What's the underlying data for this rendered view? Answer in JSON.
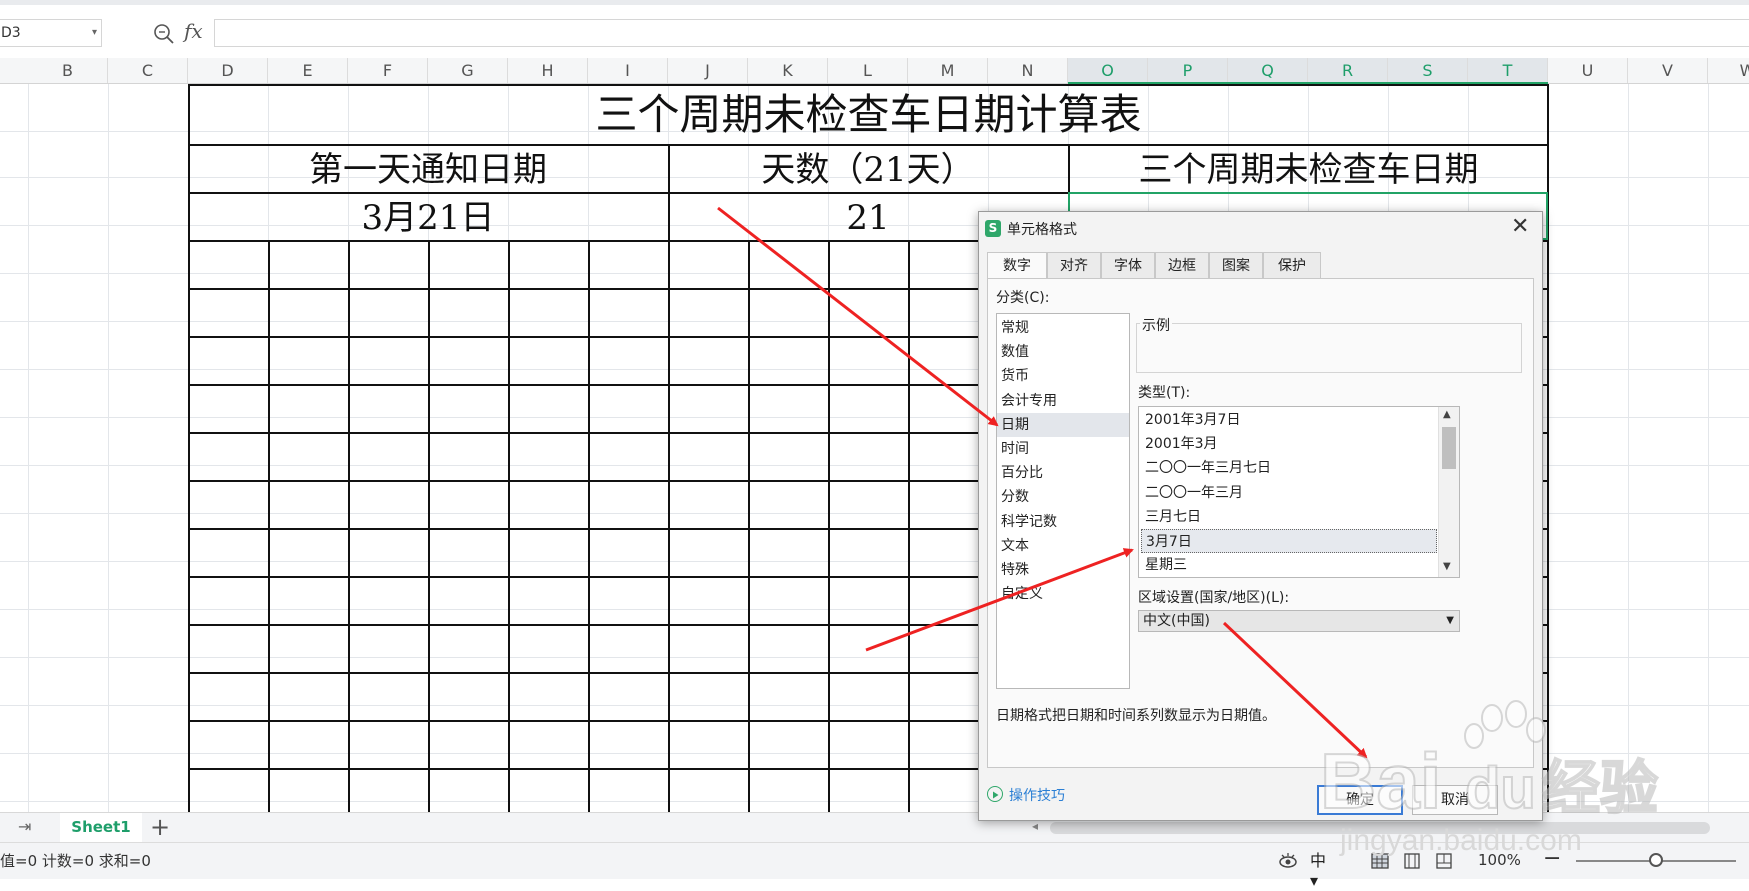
{
  "formula_bar": {
    "name_box": "D3",
    "fx": "fx",
    "formula": ""
  },
  "columns": [
    "B",
    "C",
    "D",
    "E",
    "F",
    "G",
    "H",
    "I",
    "J",
    "K",
    "L",
    "M",
    "N",
    "O",
    "P",
    "Q",
    "R",
    "S",
    "T",
    "U",
    "V",
    "W"
  ],
  "selected_columns": [
    "O",
    "P",
    "Q",
    "R",
    "S",
    "T"
  ],
  "table": {
    "title": "三个周期未检查车日期计算表",
    "header_first_day": "第一天通知日期",
    "header_days": "天数（21天）",
    "header_third_period": "三个周期未检查车日期",
    "value_first_day": "3月21日",
    "value_days": "21"
  },
  "sheet_bar": {
    "nav_end": "⇥",
    "tab": "Sheet1",
    "add": "+"
  },
  "status_bar": {
    "stats": "值=0  计数=0  求和=0",
    "zoom": "100%",
    "zoom_level": 0.5
  },
  "dialog": {
    "title": "单元格格式",
    "icon_letter": "S",
    "close": "✕",
    "tabs": [
      "数字",
      "对齐",
      "字体",
      "边框",
      "图案",
      "保护"
    ],
    "active_tab": "数字",
    "category_label": "分类(C):",
    "categories": [
      "常规",
      "数值",
      "货币",
      "会计专用",
      "日期",
      "时间",
      "百分比",
      "分数",
      "科学记数",
      "文本",
      "特殊",
      "自定义"
    ],
    "selected_category": "日期",
    "sample_label": "示例",
    "type_label": "类型(T):",
    "types": [
      "2001年3月7日",
      "2001年3月",
      "二〇〇一年三月七日",
      "二〇〇一年三月",
      "三月七日",
      "3月7日",
      "星期三"
    ],
    "selected_type": "3月7日",
    "locale_label": "区域设置(国家/地区)(L):",
    "locale_value": "中文(中国)",
    "description": "日期格式把日期和时间系列数显示为日期值。",
    "tips": "操作技巧",
    "ok": "确定",
    "cancel": "取消"
  },
  "watermark": {
    "text_top": "Bai",
    "text_du": "du",
    "text_cn": "经验",
    "url": "jingyan.baidu.com"
  },
  "colors": {
    "accent_green": "#21a366",
    "annotation_red": "#ee2222",
    "link_blue": "#2b7fd4"
  }
}
